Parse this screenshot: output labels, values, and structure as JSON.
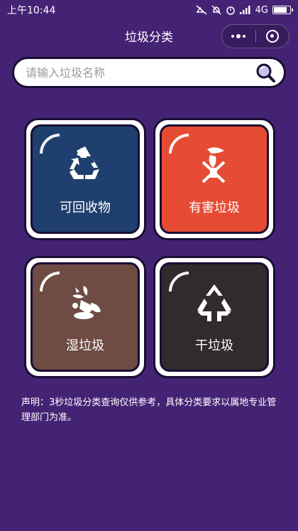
{
  "status_bar": {
    "time": "上午10:44",
    "network": "4G"
  },
  "nav": {
    "title": "垃圾分类",
    "menu_icon": "more-dots-icon",
    "close_icon": "target-circle-icon"
  },
  "search": {
    "placeholder": "请输入垃圾名称",
    "icon": "search-icon"
  },
  "categories": [
    {
      "label": "可回收物",
      "icon": "recycle-icon",
      "color": "#1f3f6e"
    },
    {
      "label": "有害垃圾",
      "icon": "hazardous-crossed-bulb-icon",
      "color": "#e64b34"
    },
    {
      "label": "湿垃圾",
      "icon": "food-waste-icon",
      "color": "#6e4b43"
    },
    {
      "label": "干垃圾",
      "icon": "dry-waste-triangle-icon",
      "color": "#312b2b"
    }
  ],
  "disclaimer": "声明：3秒垃圾分类查询仅供参考，具体分类要求以属地专业管理部门为准。",
  "colors": {
    "background": "#452374",
    "outline": "#1a0d35"
  }
}
